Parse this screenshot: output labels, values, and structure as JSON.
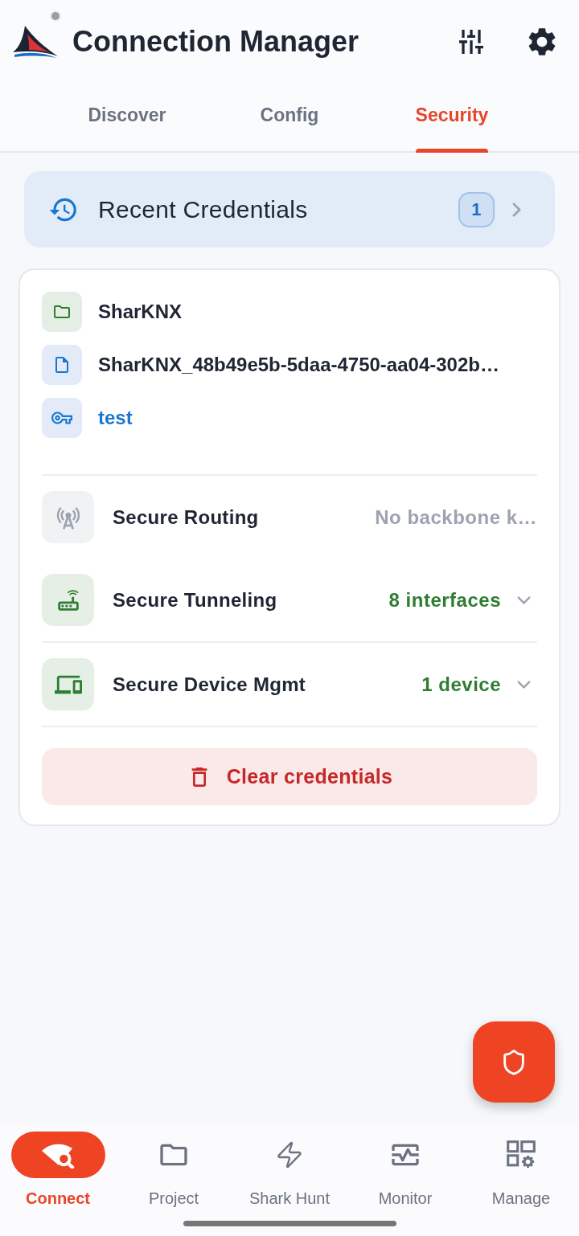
{
  "header": {
    "title": "Connection Manager",
    "connected": false
  },
  "tabs": [
    {
      "label": "Discover",
      "selected": false
    },
    {
      "label": "Config",
      "selected": false
    },
    {
      "label": "Security",
      "selected": true
    }
  ],
  "recent_credentials": {
    "label": "Recent Credentials",
    "count": "1"
  },
  "credentials": [
    {
      "kind": "project",
      "text": "SharKNX"
    },
    {
      "kind": "keyring",
      "text": "SharKNX_48b49e5b-5daa-4750-aa04-302b…"
    },
    {
      "kind": "password",
      "text": "test"
    }
  ],
  "security_sections": [
    {
      "kind": "routing",
      "label": "Secure Routing",
      "value": "No backbone k…",
      "available": false
    },
    {
      "kind": "tunneling",
      "label": "Secure Tunneling",
      "value": "8 interfaces",
      "available": true,
      "expanded": false
    },
    {
      "kind": "device",
      "label": "Secure Device Mgmt",
      "value": "1 device",
      "available": true,
      "expanded": false
    }
  ],
  "clear_button": {
    "label": "Clear credentials"
  },
  "bottom_nav": [
    {
      "label": "Connect",
      "selected": true
    },
    {
      "label": "Project",
      "selected": false
    },
    {
      "label": "Shark Hunt",
      "selected": false
    },
    {
      "label": "Monitor",
      "selected": false
    },
    {
      "label": "Manage",
      "selected": false
    }
  ]
}
